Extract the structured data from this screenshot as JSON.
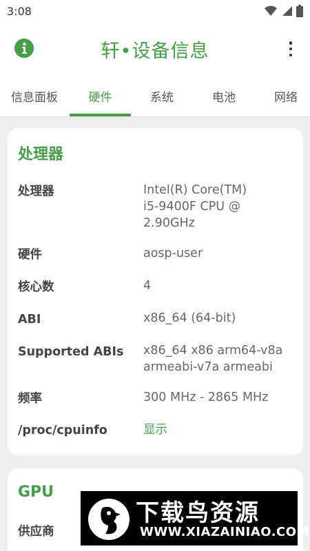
{
  "status_bar": {
    "time": "3:08",
    "icons": [
      "wifi-icon",
      "signal-icon",
      "battery-icon"
    ]
  },
  "app_bar": {
    "title": "轩•设备信息",
    "left_icon": "info-icon",
    "right_icon": "more-vert-icon"
  },
  "tabs": [
    {
      "label": "信息面板",
      "active": false
    },
    {
      "label": "硬件",
      "active": true
    },
    {
      "label": "系统",
      "active": false
    },
    {
      "label": "电池",
      "active": false
    },
    {
      "label": "网络",
      "active": false
    }
  ],
  "cpu_card": {
    "title": "处理器",
    "rows": [
      {
        "label": "处理器",
        "value_lines": [
          "Intel(R) Core(TM)",
          "i5-9400F CPU @",
          "2.90GHz"
        ]
      },
      {
        "label": "硬件",
        "value_lines": [
          "aosp-user"
        ]
      },
      {
        "label": "核心数",
        "value_lines": [
          "4"
        ]
      },
      {
        "label": "ABI",
        "value_lines": [
          "x86_64 (64-bit)"
        ]
      },
      {
        "label": "Supported ABIs",
        "value_lines": [
          "x86_64 x86 arm64-v8a",
          "armeabi-v7a armeabi"
        ]
      },
      {
        "label": "频率",
        "value_lines": [
          "300 MHz - 2865 MHz"
        ]
      },
      {
        "label": "/proc/cpuinfo",
        "value_lines": [
          "显示"
        ]
      }
    ]
  },
  "gpu_card": {
    "title": "GPU",
    "rows": [
      {
        "label": "供应商"
      }
    ]
  },
  "watermark": {
    "title": "下载鸟资源",
    "url": "WWW.XIAZAINIAO.COM"
  },
  "colors": {
    "accent": "#43a047",
    "background": "#efefef",
    "card": "#ffffff",
    "label": "#444444",
    "value": "#666666"
  }
}
